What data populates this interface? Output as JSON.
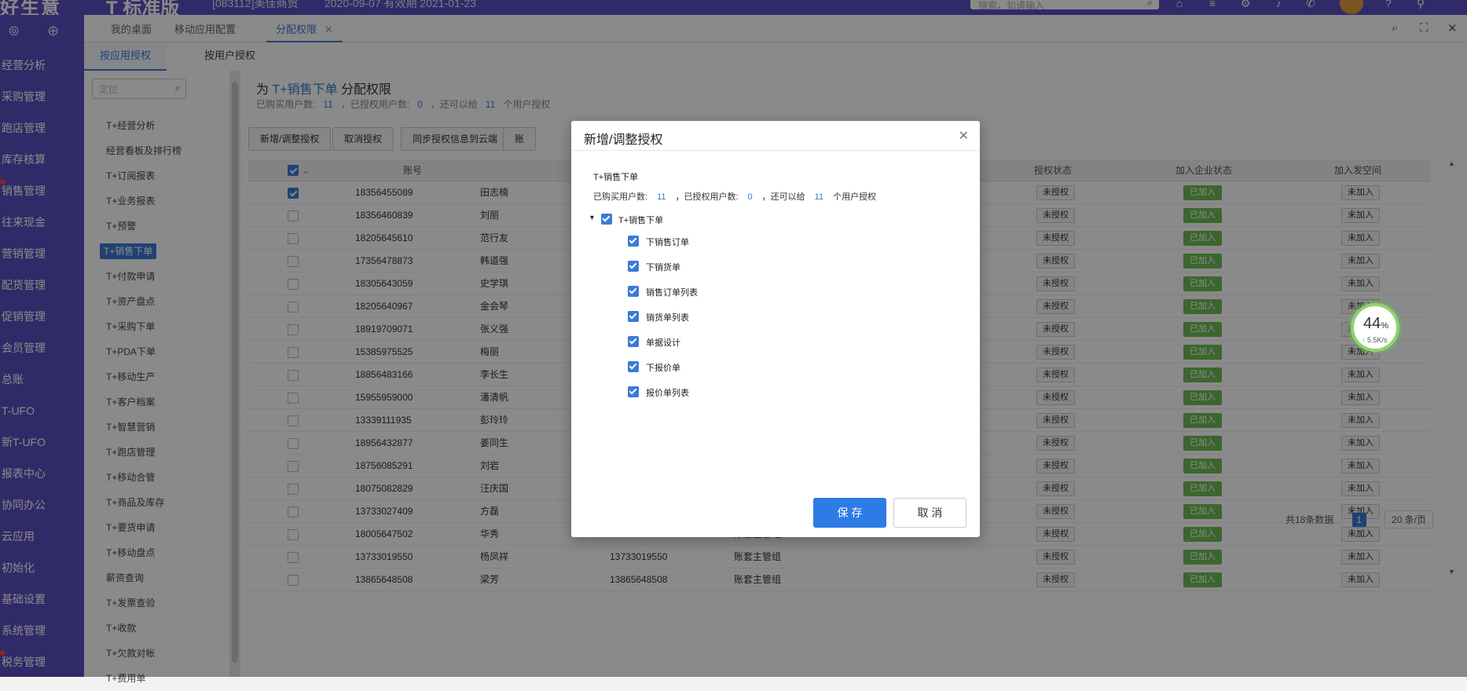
{
  "topbar": {
    "brand": "好生意",
    "edition": "T 标准版",
    "account": "[083112]美佳商贸",
    "date": "2020-09-07  有效期 2021-01-23",
    "search_placeholder": "搜索，如请输入"
  },
  "leftnav": {
    "items": [
      "经营分析",
      "采购管理",
      "跑店管理",
      "库存核算",
      "销售管理",
      "往来现金",
      "营销管理",
      "配货管理",
      "促销管理",
      "会员管理",
      "总账",
      "T-UFO",
      "新T-UFO",
      "报表中心",
      "协同办公",
      "云应用",
      "初始化",
      "基础设置",
      "系统管理",
      "税务管理"
    ]
  },
  "tabs": {
    "desk": "我的桌面",
    "mobile": "移动应用配置",
    "assign": "分配权限"
  },
  "subtabs": {
    "by_app": "按应用授权",
    "by_user": "按用户授权"
  },
  "funcpanel": {
    "search_placeholder": "定位",
    "items": [
      "T+经营分析",
      "经营看板及排行榜",
      "T+订阅报表",
      "T+业务报表",
      "T+预警",
      "T+销售下单",
      "T+付款申请",
      "T+资产盘点",
      "T+采购下单",
      "T+PDA下单",
      "T+移动生产",
      "T+客户档案",
      "T+智慧营销",
      "T+跑店管理",
      "T+移动合管",
      "T+商品及库存",
      "T+要货申请",
      "T+移动盘点",
      "薪资查询",
      "T+发票查验",
      "T+收款",
      "T+欠款对帐",
      "T+费用单"
    ]
  },
  "content": {
    "title_pre": "为",
    "title_func": "T+销售下单",
    "title_post": "分配权限",
    "stat_bought": "已购买用户数:",
    "stat_bought_n": "11",
    "stat_assigned": "，已授权用户数:",
    "stat_assigned_n": "0",
    "stat_remain": "，还可以给",
    "stat_remain_n": "11",
    "stat_tail": "个用户授权",
    "buttons": {
      "add": "新增/调整授权",
      "cancel": "取消授权",
      "sync": "同步授权信息到云端",
      "more": "账"
    },
    "headers": {
      "account": "账号",
      "status": "授权状态",
      "ent": "加入企业状态",
      "space": "加入发空间"
    },
    "rows": [
      {
        "acc": "18356455089",
        "name": "田志楠",
        "phone": "",
        "role": "",
        "checked": true
      },
      {
        "acc": "18356460839",
        "name": "刘丽",
        "phone": "",
        "role": "",
        "checked": false
      },
      {
        "acc": "18205645610",
        "name": "范行友",
        "phone": "",
        "role": "",
        "checked": false
      },
      {
        "acc": "17356478873",
        "name": "韩道强",
        "phone": "",
        "role": "",
        "checked": false
      },
      {
        "acc": "18305643059",
        "name": "史学琪",
        "phone": "",
        "role": "",
        "checked": false
      },
      {
        "acc": "18205640967",
        "name": "金会琴",
        "phone": "",
        "role": "",
        "checked": false
      },
      {
        "acc": "18919709071",
        "name": "张义强",
        "phone": "",
        "role": "",
        "checked": false
      },
      {
        "acc": "15385975525",
        "name": "梅丽",
        "phone": "",
        "role": "",
        "checked": false
      },
      {
        "acc": "18856483166",
        "name": "李长生",
        "phone": "",
        "role": "",
        "checked": false
      },
      {
        "acc": "15955959000",
        "name": "潘清帆",
        "phone": "",
        "role": "",
        "checked": false
      },
      {
        "acc": "13339111935",
        "name": "彭玲玲",
        "phone": "",
        "role": "",
        "checked": false
      },
      {
        "acc": "18956432877",
        "name": "姜同生",
        "phone": "",
        "role": "",
        "checked": false
      },
      {
        "acc": "18756085291",
        "name": "刘岩",
        "phone": "",
        "role": "",
        "checked": false
      },
      {
        "acc": "18075082829",
        "name": "汪庆国",
        "phone": "",
        "role": "",
        "checked": false
      },
      {
        "acc": "13733027409",
        "name": "方磊",
        "phone": "",
        "role": "",
        "checked": false
      },
      {
        "acc": "18005647502",
        "name": "华秀",
        "phone": "18005647502",
        "role": "账套主管组",
        "checked": false
      },
      {
        "acc": "13733019550",
        "name": "杨凤祥",
        "phone": "13733019550",
        "role": "账套主管组",
        "checked": false
      },
      {
        "acc": "13865648508",
        "name": "梁芳",
        "phone": "13865648508",
        "role": "账套主管组",
        "checked": false
      }
    ],
    "status_unassigned": "未授权",
    "joined": "已加入",
    "not_joined": "未加入",
    "pager": {
      "total": "共18条数据",
      "page": "1",
      "size": "20 条/页"
    }
  },
  "speed": {
    "pct": "44",
    "pct_unit": "%",
    "rate": "5.5K/s"
  },
  "modal": {
    "title": "新增/调整授权",
    "func": "T+销售下单",
    "stat_bought": "已购买用户数:",
    "stat_bought_n": "11",
    "stat_assigned": "，已授权用户数:",
    "stat_assigned_n": "0",
    "stat_remain": "，还可以给",
    "stat_remain_n": "11",
    "stat_tail": "个用户授权",
    "root": "T+销售下单",
    "children": [
      "下销售订单",
      "下销货单",
      "销售订单列表",
      "销货单列表",
      "单据设计",
      "下报价单",
      "报价单列表"
    ],
    "save": "保 存",
    "cancel": "取 消"
  }
}
